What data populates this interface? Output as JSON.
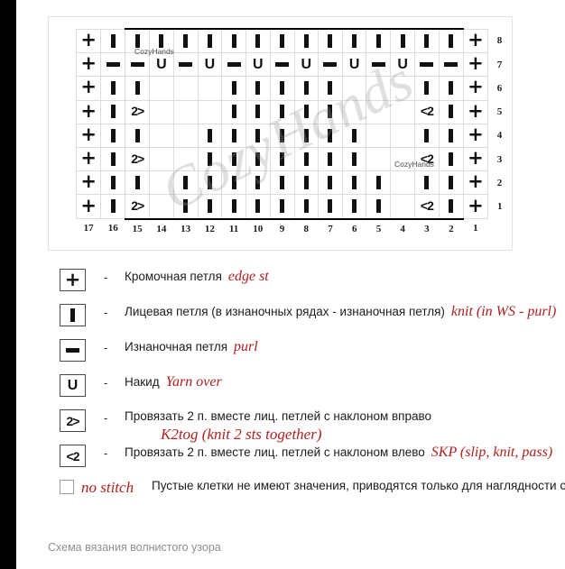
{
  "chart": {
    "title_caption": "Схема вязания волнистого узора",
    "column_numbers": [
      17,
      16,
      15,
      14,
      13,
      12,
      11,
      10,
      9,
      8,
      7,
      6,
      5,
      4,
      3,
      2,
      1
    ],
    "row_numbers": [
      8,
      7,
      6,
      5,
      4,
      3,
      2,
      1
    ],
    "repeat_box": {
      "from_col": 15,
      "to_col": 2
    },
    "symbols": {
      "edge": "+",
      "knit": "I",
      "purl": "-",
      "yarn_over": "U",
      "k2tog": "2>",
      "skp": "<2",
      "empty": ""
    },
    "watermark_text": "CozyHands",
    "watermark_big": "CozyHands",
    "rows": [
      {
        "number": 8,
        "cells": [
          "edge",
          "knit",
          "knit",
          "knit",
          "knit",
          "knit",
          "knit",
          "knit",
          "knit",
          "knit",
          "knit",
          "knit",
          "knit",
          "knit",
          "knit",
          "knit",
          "edge"
        ]
      },
      {
        "number": 7,
        "cells": [
          "edge",
          "purl",
          "purl",
          "yarn_over",
          "purl",
          "yarn_over",
          "purl",
          "yarn_over",
          "purl",
          "yarn_over",
          "purl",
          "yarn_over",
          "purl",
          "yarn_over",
          "purl",
          "purl",
          "edge"
        ]
      },
      {
        "number": 6,
        "cells": [
          "edge",
          "knit",
          "knit",
          "empty",
          "empty",
          "empty",
          "knit",
          "knit",
          "knit",
          "knit",
          "knit",
          "empty",
          "empty",
          "empty",
          "knit",
          "knit",
          "edge"
        ]
      },
      {
        "number": 5,
        "cells": [
          "edge",
          "knit",
          "k2tog",
          "empty",
          "empty",
          "empty",
          "knit",
          "knit",
          "knit",
          "knit",
          "knit",
          "empty",
          "empty",
          "empty",
          "skp",
          "knit",
          "edge"
        ]
      },
      {
        "number": 4,
        "cells": [
          "edge",
          "knit",
          "knit",
          "empty",
          "empty",
          "knit",
          "knit",
          "knit",
          "knit",
          "knit",
          "knit",
          "knit",
          "empty",
          "empty",
          "knit",
          "knit",
          "edge"
        ]
      },
      {
        "number": 3,
        "cells": [
          "edge",
          "knit",
          "k2tog",
          "empty",
          "empty",
          "knit",
          "knit",
          "knit",
          "knit",
          "knit",
          "knit",
          "knit",
          "empty",
          "empty",
          "skp",
          "knit",
          "edge"
        ]
      },
      {
        "number": 2,
        "cells": [
          "edge",
          "knit",
          "knit",
          "empty",
          "knit",
          "knit",
          "knit",
          "knit",
          "knit",
          "knit",
          "knit",
          "knit",
          "knit",
          "empty",
          "knit",
          "knit",
          "edge"
        ]
      },
      {
        "number": 1,
        "cells": [
          "edge",
          "knit",
          "k2tog",
          "empty",
          "knit",
          "knit",
          "knit",
          "knit",
          "knit",
          "knit",
          "knit",
          "knit",
          "knit",
          "empty",
          "skp",
          "knit",
          "edge"
        ]
      }
    ]
  },
  "legend": {
    "dash": "-",
    "items": [
      {
        "symbol": "edge",
        "ru": "Кромочная петля",
        "en": "edge st",
        "en_below": ""
      },
      {
        "symbol": "knit",
        "ru": "Лицевая петля (в изнаночных рядах - изнаночная петля)",
        "en": "knit (in WS - purl)",
        "en_below": ""
      },
      {
        "symbol": "purl",
        "ru": "Изнаночная петля",
        "en": "purl",
        "en_below": ""
      },
      {
        "symbol": "yarn_over",
        "ru": "Накид",
        "en": "Yarn over",
        "en_below": ""
      },
      {
        "symbol": "k2tog",
        "ru": "Провязать 2 п. вместе лиц. петлей с наклоном вправо",
        "en": "",
        "en_below": "K2tog (knit 2 sts together)"
      },
      {
        "symbol": "skp",
        "ru": "Провязать 2 п. вместе лиц. петлей с наклоном влево",
        "en": "SKP (slip, knit, pass)",
        "en_below": ""
      }
    ],
    "no_stitch": {
      "en": "no stitch",
      "ru": "Пустые клетки не имеют значения, приводятся только для наглядности схемы"
    }
  }
}
